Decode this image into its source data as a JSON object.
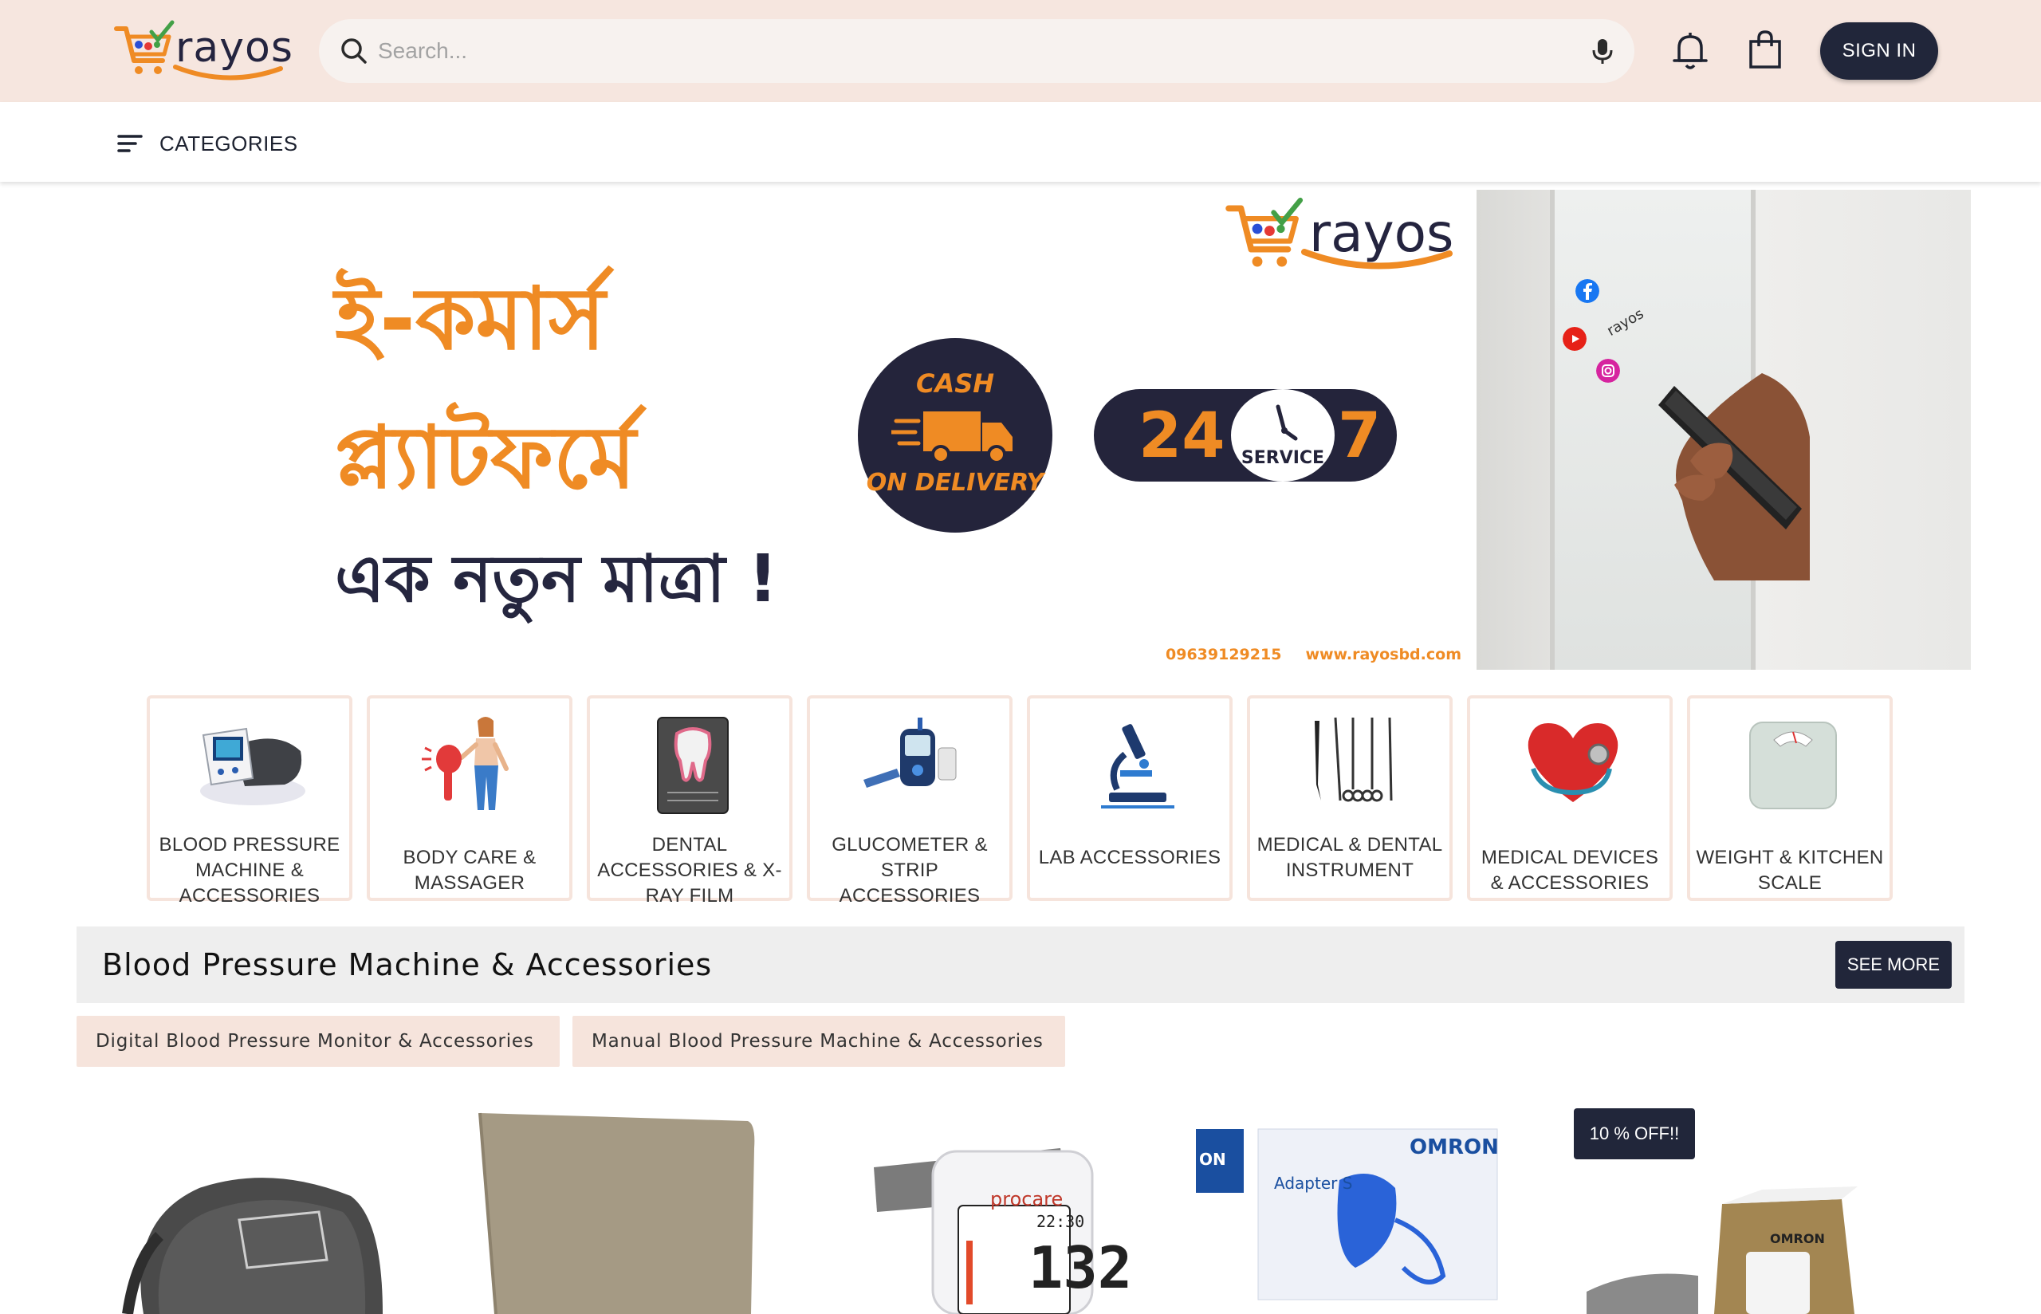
{
  "header": {
    "logo_text": "rayos",
    "search_placeholder": "Search...",
    "sign_in_label": "SIGN IN"
  },
  "nav": {
    "categories_label": "CATEGORIES"
  },
  "banner": {
    "headline_line1": "ই-কমার্স",
    "headline_line2": "প্ল্যাটফর্মে",
    "headline_line3": "এক নতুন মাত্রা !",
    "cash_top": "CASH",
    "cash_bottom": "ON DELIVERY",
    "service_24": "24",
    "service_7": "7",
    "service_label": "SERVICE",
    "logo_text": "rayos",
    "phone": "09639129215",
    "website": "www.rayosbd.com",
    "phone_brand": "rayos"
  },
  "categories": [
    {
      "label": "BLOOD PRESSURE MACHINE & ACCESSORIES"
    },
    {
      "label": "BODY CARE & MASSAGER"
    },
    {
      "label": "DENTAL ACCESSORIES & X- RAY FILM"
    },
    {
      "label": "GLUCOMETER & STRIP ACCESSORIES"
    },
    {
      "label": "LAB ACCESSORIES"
    },
    {
      "label": "MEDICAL & DENTAL INSTRUMENT"
    },
    {
      "label": "MEDICAL DEVICES & ACCESSORIES"
    },
    {
      "label": "WEIGHT & KITCHEN SCALE"
    }
  ],
  "section": {
    "title": "Blood Pressure Machine & Accessories",
    "see_more": "SEE MORE",
    "chips": [
      "Digital Blood Pressure Monitor & Accessories",
      "Manual Blood Pressure Machine & Accessories"
    ]
  },
  "products": {
    "badge": "10 % OFF!!",
    "product3_brand": "procare",
    "product3_screen_top": "22:30",
    "product3_screen_value": "132",
    "product4_brand": "OMRON",
    "product4_name": "Adapter S",
    "product4_tag": "ON",
    "product5_brand": "OMRON"
  },
  "colors": {
    "brand_orange": "#ef8b24",
    "brand_navy": "#21263a",
    "header_bg": "#f6e6df",
    "chip_bg": "#f6e4dc"
  }
}
